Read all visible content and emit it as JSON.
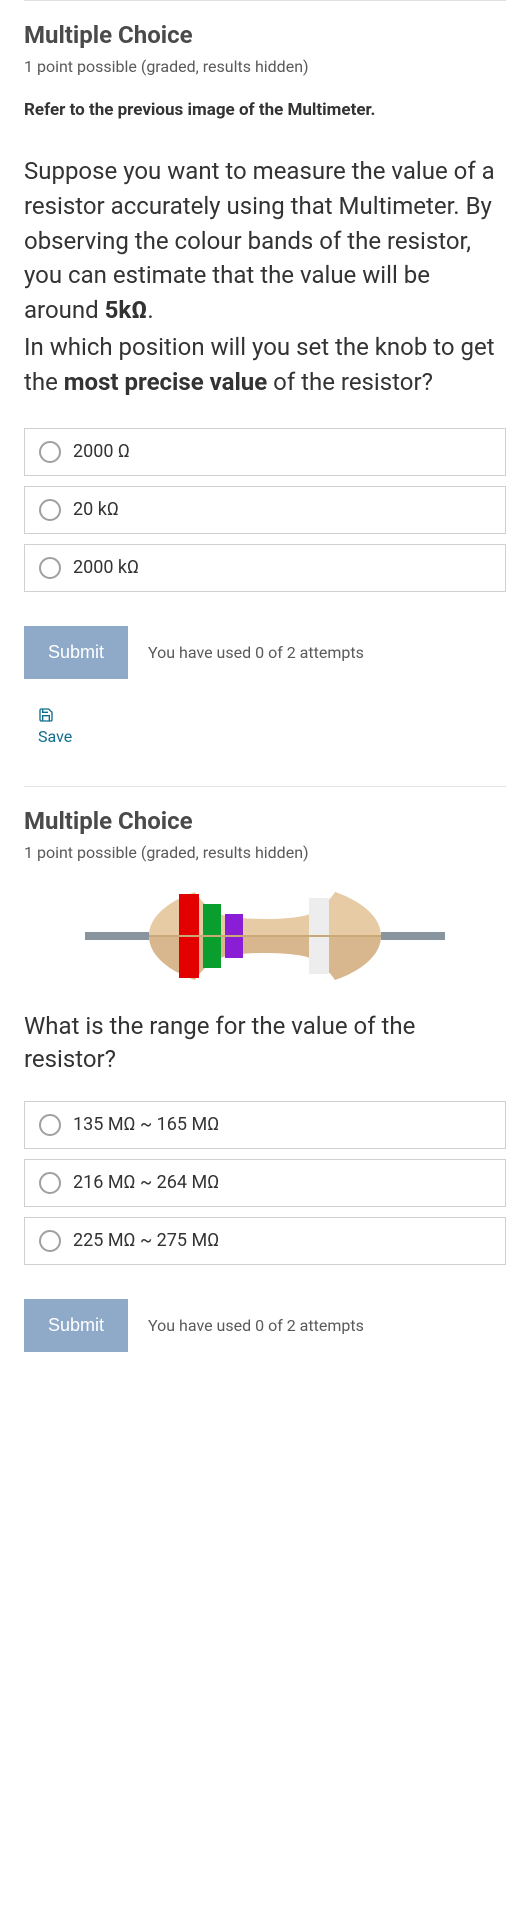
{
  "q1": {
    "title": "Multiple Choice",
    "meta": "1 point possible (graded, results hidden)",
    "refer": "Refer to the previous image of the Multimeter.",
    "para1_a": "Suppose you want to measure the value of a resistor accurately using that Multimeter. By observing the colour bands of the resistor, you can estimate that the value will be around ",
    "para1_bold": "5kΩ",
    "para1_b": ".",
    "para2_a": "In which position will you set the knob to get the ",
    "para2_bold": "most precise value",
    "para2_b": " of the resistor?",
    "options": [
      "2000 Ω",
      "20 kΩ",
      "2000 kΩ"
    ],
    "submit": "Submit",
    "attempts": "You have used 0 of 2 attempts",
    "save": "Save"
  },
  "q2": {
    "title": "Multiple Choice",
    "meta": "1 point possible (graded, results hidden)",
    "question": "What is the range for the value of the resistor?",
    "options": [
      "135 MΩ ~ 165 MΩ",
      "216 MΩ ~ 264 MΩ",
      "225 MΩ ~ 275 MΩ"
    ],
    "submit": "Submit",
    "attempts": "You have used 0 of 2 attempts"
  },
  "resistor": {
    "bands": [
      "red",
      "green",
      "violet",
      "silver"
    ]
  }
}
